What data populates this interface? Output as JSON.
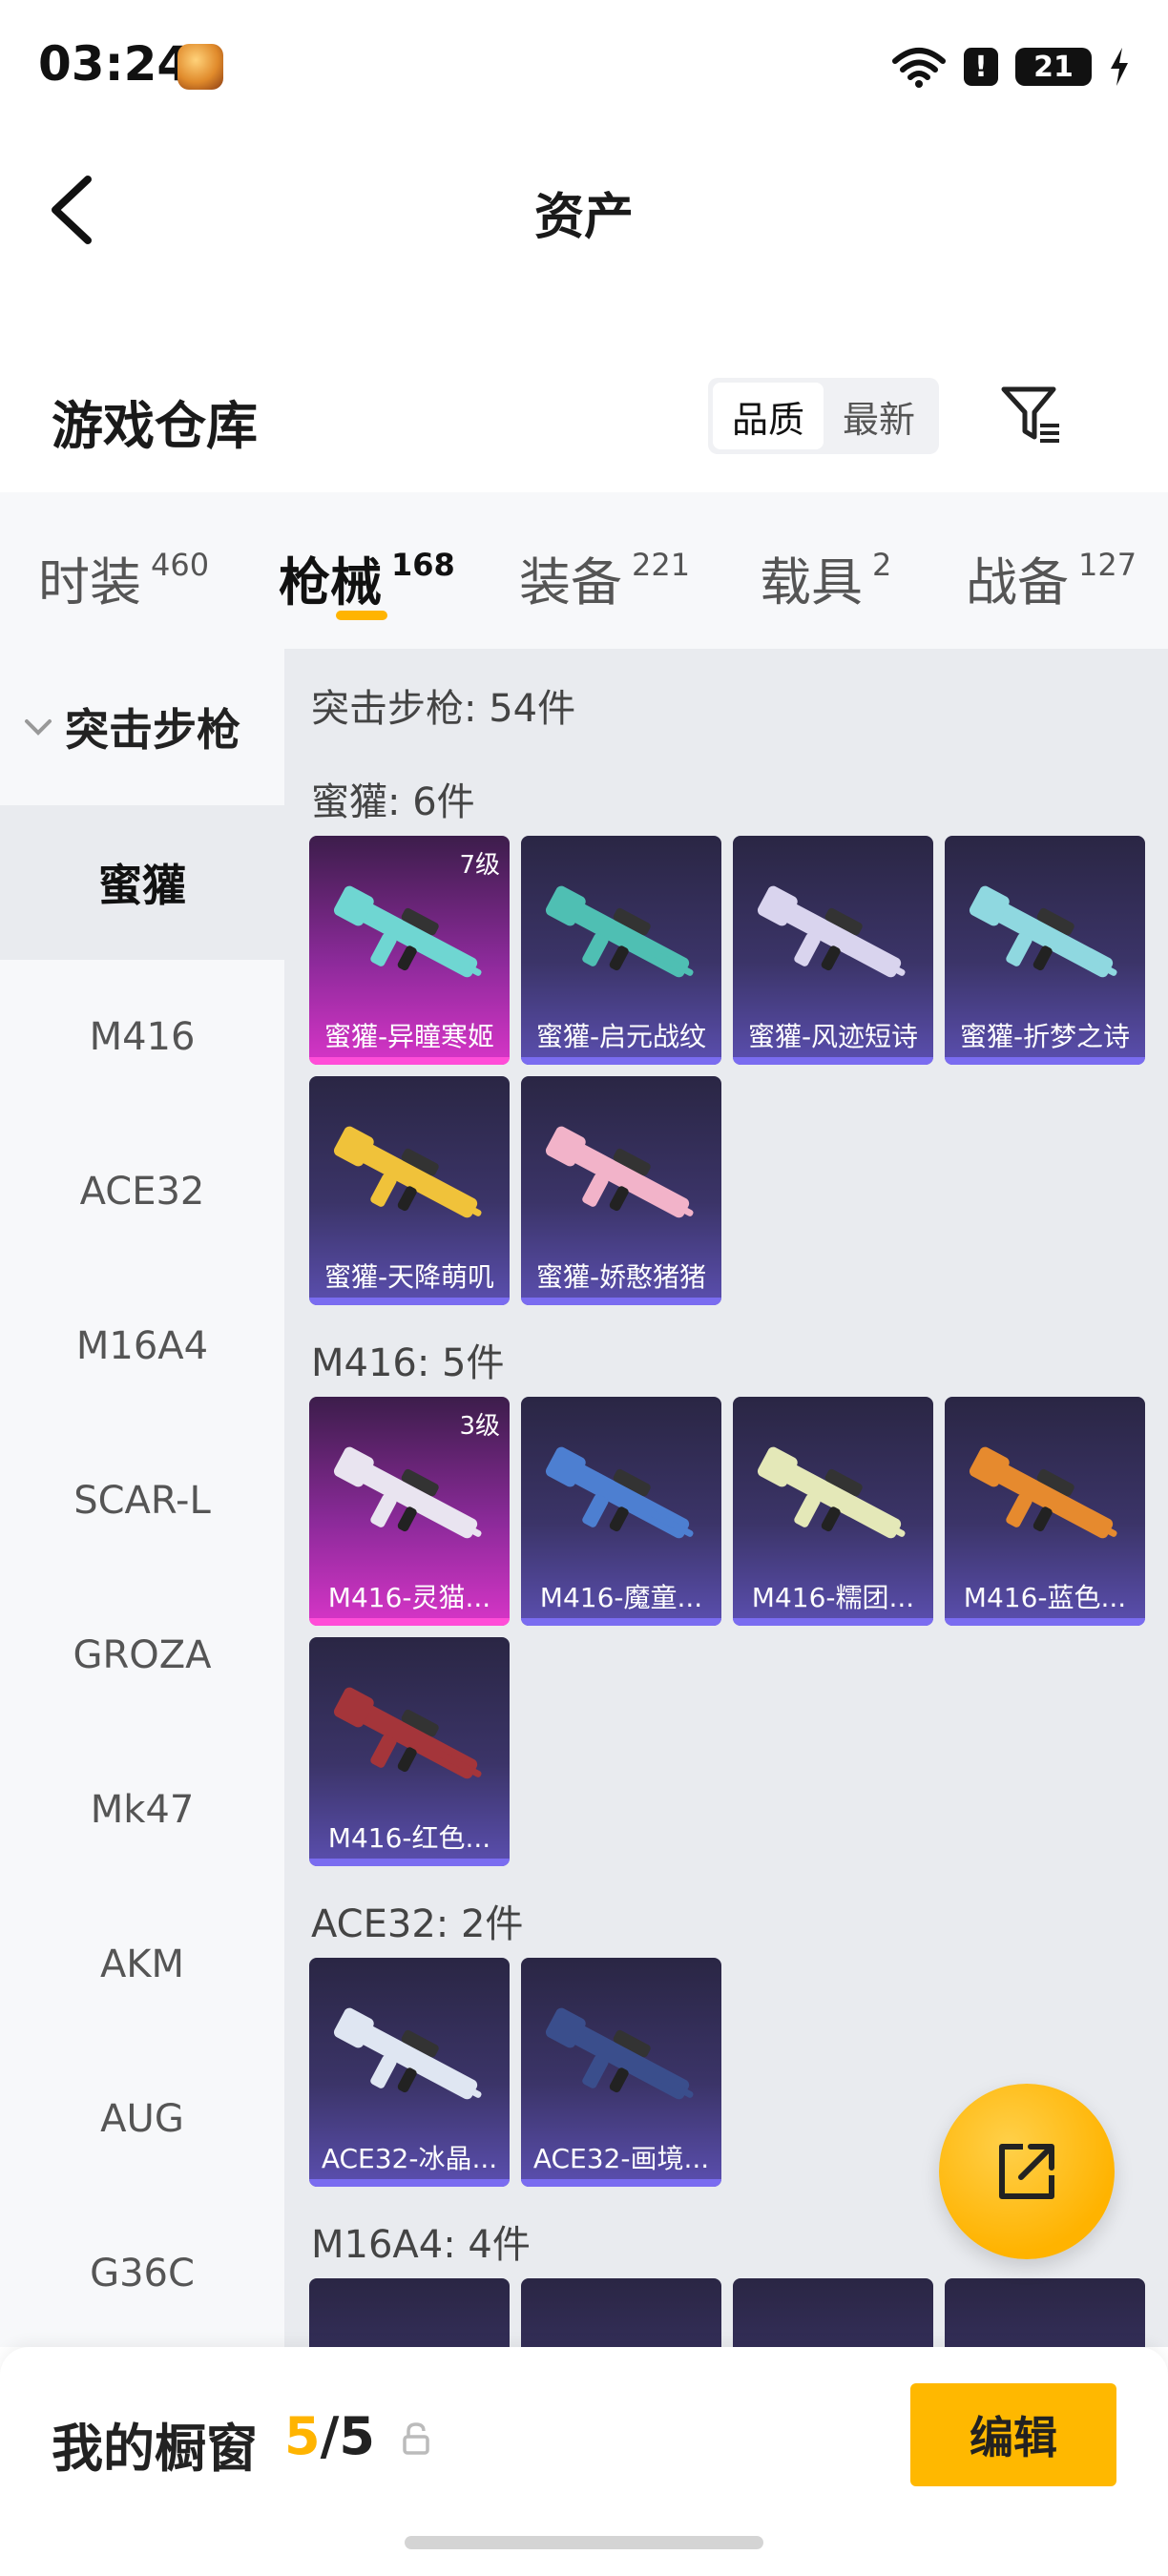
{
  "status_bar": {
    "time": "03:24",
    "battery": "21",
    "alert": "!"
  },
  "nav": {
    "title": "资产"
  },
  "section": {
    "title": "游戏仓库",
    "sort_options": [
      "品质",
      "最新"
    ]
  },
  "tabs": [
    {
      "label": "时装",
      "count": "460"
    },
    {
      "label": "枪械",
      "count": "168"
    },
    {
      "label": "装备",
      "count": "221"
    },
    {
      "label": "载具",
      "count": "2"
    },
    {
      "label": "战备",
      "count": "127"
    }
  ],
  "sidebar": {
    "group": "突击步枪",
    "items": [
      "蜜獾",
      "M416",
      "ACE32",
      "M16A4",
      "SCAR-L",
      "GROZA",
      "Mk47",
      "AKM",
      "AUG",
      "G36C"
    ]
  },
  "content": {
    "total": "突击步枪: 54件",
    "groups": [
      {
        "label": "蜜獾: 6件",
        "items": [
          {
            "name": "蜜獾-异瞳寒姬",
            "level": "7级",
            "rarity": "pink",
            "color": "#6fd6d2"
          },
          {
            "name": "蜜獾-启元战纹",
            "level": "",
            "rarity": "purple",
            "color": "#4fbfb3"
          },
          {
            "name": "蜜獾-风迹短诗",
            "level": "",
            "rarity": "purple",
            "color": "#d9d4ee"
          },
          {
            "name": "蜜獾-折梦之诗",
            "level": "",
            "rarity": "purple",
            "color": "#8fd8e0"
          },
          {
            "name": "蜜獾-天降萌叽",
            "level": "",
            "rarity": "purple",
            "color": "#f0c23a"
          },
          {
            "name": "蜜獾-娇憨猪猪",
            "level": "",
            "rarity": "purple",
            "color": "#f2b3c9"
          }
        ]
      },
      {
        "label": "M416: 5件",
        "items": [
          {
            "name": "M416-灵猫...",
            "level": "3级",
            "rarity": "pink",
            "color": "#e9e4f0"
          },
          {
            "name": "M416-魔童...",
            "level": "",
            "rarity": "purple",
            "color": "#4d7fd1"
          },
          {
            "name": "M416-糯团...",
            "level": "",
            "rarity": "purple",
            "color": "#e4e8b8"
          },
          {
            "name": "M416-蓝色...",
            "level": "",
            "rarity": "purple",
            "color": "#e68a2e"
          },
          {
            "name": "M416-红色...",
            "level": "",
            "rarity": "purple",
            "color": "#a4353a"
          }
        ]
      },
      {
        "label": "ACE32: 2件",
        "items": [
          {
            "name": "ACE32-冰晶...",
            "level": "",
            "rarity": "purple",
            "color": "#dfe6f2"
          },
          {
            "name": "ACE32-画境...",
            "level": "",
            "rarity": "purple",
            "color": "#3a4e8c"
          }
        ]
      },
      {
        "label": "M16A4: 4件",
        "items": []
      }
    ]
  },
  "bottom": {
    "label": "我的橱窗",
    "count_current": "5",
    "count_sep": "/",
    "count_total": "5",
    "edit_label": "编辑"
  },
  "colors": {
    "accent": "#ffb400",
    "pink_rarity": "#d835c8",
    "purple_rarity": "#5b4fb0"
  }
}
